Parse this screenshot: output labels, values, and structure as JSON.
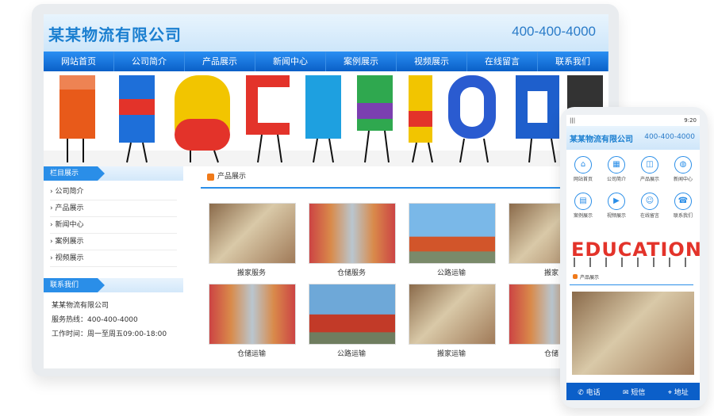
{
  "desktop": {
    "logo": "某某物流有限公司",
    "phone": "400-400-4000",
    "nav": [
      "网站首页",
      "公司简介",
      "产品展示",
      "新闻中心",
      "案例展示",
      "视频展示",
      "在线留言",
      "联系我们"
    ],
    "sidebar": {
      "title": "栏目展示",
      "items": [
        "公司简介",
        "产品展示",
        "新闻中心",
        "案例展示",
        "视频展示"
      ]
    },
    "contact": {
      "title": "联系我们",
      "lines": [
        "某某物流有限公司",
        "服务热线：400-400-4000",
        "工作时间：周一至周五09:00-18:00"
      ]
    },
    "products": {
      "title": "产品展示",
      "items": [
        {
          "label": "搬家服务",
          "img": "moving"
        },
        {
          "label": "仓储服务",
          "img": "warehouse"
        },
        {
          "label": "公路运输",
          "img": "truck"
        },
        {
          "label": "搬家",
          "img": "moving"
        },
        {
          "label": "仓储运输",
          "img": "warehouse"
        },
        {
          "label": "公路运输",
          "img": "truck"
        },
        {
          "label": "搬家运输",
          "img": "moving"
        },
        {
          "label": "仓储",
          "img": "warehouse"
        }
      ]
    },
    "banner_text": "EDUCATION"
  },
  "mobile": {
    "status_left": "|||",
    "status_right": "9:20",
    "logo": "某某物流有限公司",
    "phone": "400-400-4000",
    "icons": [
      {
        "label": "网站首页",
        "icon": "home-icon"
      },
      {
        "label": "公司简介",
        "icon": "company-icon"
      },
      {
        "label": "产品展示",
        "icon": "product-icon"
      },
      {
        "label": "新闻中心",
        "icon": "globe-icon"
      },
      {
        "label": "案例展示",
        "icon": "grid-icon"
      },
      {
        "label": "视频展示",
        "icon": "video-icon"
      },
      {
        "label": "在线留言",
        "icon": "message-icon"
      },
      {
        "label": "联系我们",
        "icon": "contact-icon"
      }
    ],
    "banner_text": "EDUCATION",
    "section_title": "产品展示",
    "bottom": [
      "电话",
      "短信",
      "地址"
    ]
  },
  "colors": {
    "primary": "#1a7fe0",
    "nav": "#0a5fc7",
    "accent": "#f07a1a"
  }
}
